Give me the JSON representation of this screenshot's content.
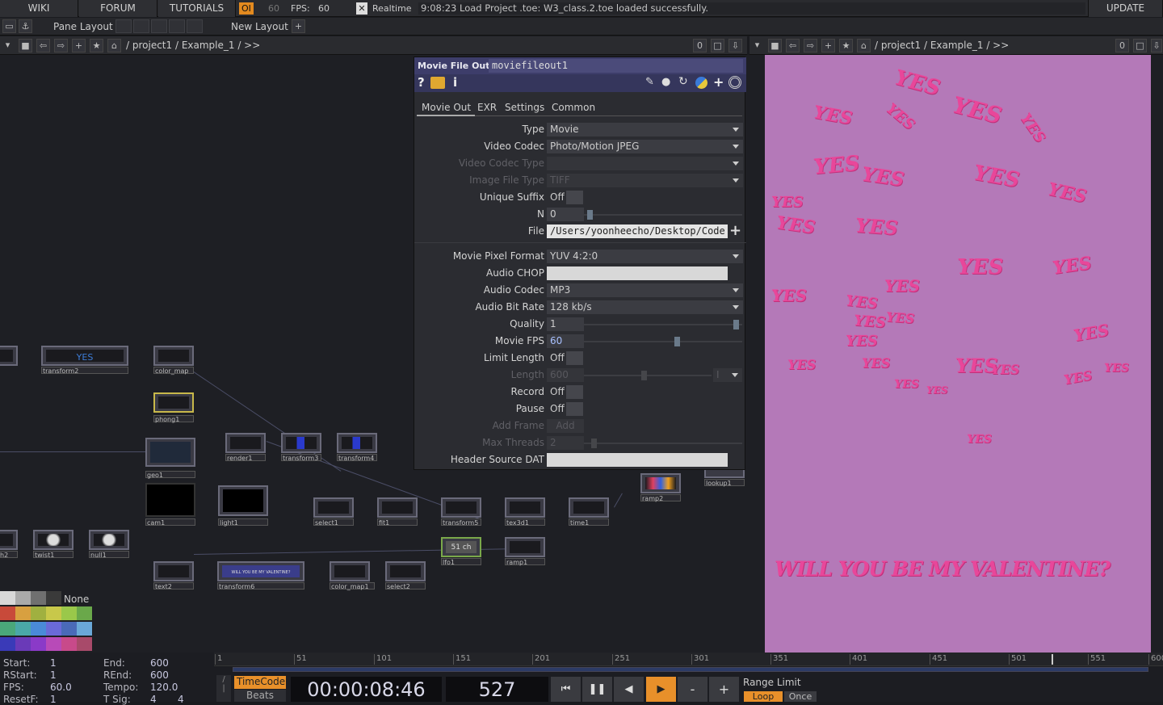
{
  "topbar": {
    "wiki": "WIKI",
    "forum": "FORUM",
    "tutorials": "TUTORIALS",
    "oi": "OI",
    "fps_target": "60",
    "fps_label": "FPS:",
    "fps_value": "60",
    "realtime_check": "✕",
    "realtime_label": "Realtime",
    "status_message": "9:08:23 Load Project .toe: W3_class.2.toe loaded successfully.",
    "update": "UPDATE"
  },
  "bar2": {
    "pane_layout": "Pane Layout",
    "new_layout": "New Layout",
    "plus": "+"
  },
  "left_path": {
    "path": "/ project1 / Example_1 / >>",
    "zero": "0"
  },
  "right_path": {
    "path": "/ project1 / Example_1 / >>",
    "zero": "0"
  },
  "param": {
    "op_type": "Movie File Out",
    "op_name": "moviefileout1",
    "tabs": [
      "Movie Out",
      "EXR",
      "Settings",
      "Common"
    ],
    "rows": [
      {
        "label": "Type",
        "value": "Movie",
        "kind": "dropdown",
        "dim": false
      },
      {
        "label": "Video Codec",
        "value": "Photo/Motion JPEG",
        "kind": "dropdown",
        "dim": false
      },
      {
        "label": "Video Codec Type",
        "value": "",
        "kind": "dropdown",
        "dim": true
      },
      {
        "label": "Image File Type",
        "value": "TIFF",
        "kind": "dropdown",
        "dim": true
      },
      {
        "label": "Unique Suffix",
        "value": "Off",
        "kind": "toggle",
        "dim": false
      },
      {
        "label": "N",
        "value": "0",
        "kind": "slider",
        "dim": false
      },
      {
        "label": "File",
        "value": "/Users/yoonheecho/Desktop/Code",
        "kind": "file",
        "dim": false
      },
      {
        "label": "Movie Pixel Format",
        "value": "YUV 4:2:0",
        "kind": "dropdown",
        "dim": false
      },
      {
        "label": "Audio CHOP",
        "value": "",
        "kind": "opref",
        "dim": false
      },
      {
        "label": "Audio Codec",
        "value": "MP3",
        "kind": "dropdown",
        "dim": false
      },
      {
        "label": "Audio Bit Rate",
        "value": "128 kb/s",
        "kind": "dropdown",
        "dim": false
      },
      {
        "label": "Quality",
        "value": "1",
        "kind": "slider",
        "dim": false
      },
      {
        "label": "Movie FPS",
        "value": "60",
        "kind": "slider",
        "dim": false
      },
      {
        "label": "Limit Length",
        "value": "Off",
        "kind": "toggle",
        "dim": false
      },
      {
        "label": "Length",
        "value": "600",
        "kind": "slider-unit",
        "dim": true,
        "unit": "I"
      },
      {
        "label": "Record",
        "value": "Off",
        "kind": "toggle",
        "dim": false
      },
      {
        "label": "Pause",
        "value": "Off",
        "kind": "toggle",
        "dim": false
      },
      {
        "label": "Add Frame",
        "value": "Add",
        "kind": "button",
        "dim": true
      },
      {
        "label": "Max Threads",
        "value": "2",
        "kind": "slider",
        "dim": true
      },
      {
        "label": "Header Source DAT",
        "value": "",
        "kind": "opref",
        "dim": false
      }
    ]
  },
  "nodes": [
    {
      "name": "transform2",
      "label": "transform2",
      "thumb": "YES"
    },
    {
      "name": "color-map",
      "label": "color_map",
      "thumb": ""
    },
    {
      "name": "phong1",
      "label": "phong1",
      "thumb": ""
    },
    {
      "name": "geo1",
      "label": "geo1",
      "thumb": ""
    },
    {
      "name": "render1",
      "label": "render1",
      "thumb": ""
    },
    {
      "name": "transform3",
      "label": "transform3",
      "thumb": ""
    },
    {
      "name": "transform4",
      "label": "transform4",
      "thumb": ""
    },
    {
      "name": "cam1",
      "label": "cam1",
      "thumb": ""
    },
    {
      "name": "light1",
      "label": "light1",
      "thumb": ""
    },
    {
      "name": "select1",
      "label": "select1",
      "thumb": ""
    },
    {
      "name": "fit1",
      "label": "fit1",
      "thumb": ""
    },
    {
      "name": "transform5",
      "label": "transform5",
      "thumb": ""
    },
    {
      "name": "tex3d1",
      "label": "tex3d1",
      "thumb": ""
    },
    {
      "name": "time1",
      "label": "time1",
      "thumb": ""
    },
    {
      "name": "ramp2",
      "label": "ramp2",
      "thumb": ""
    },
    {
      "name": "lookup1",
      "label": "lookup1",
      "thumb": ""
    },
    {
      "name": "lfo1",
      "label": "lfo1",
      "thumb": "51 ch"
    },
    {
      "name": "ramp1",
      "label": "ramp1",
      "thumb": ""
    },
    {
      "name": "twist1",
      "label": "twist1",
      "thumb": ""
    },
    {
      "name": "null1",
      "label": "null1",
      "thumb": ""
    },
    {
      "name": "h2",
      "label": "h2",
      "thumb": ""
    },
    {
      "name": "text2",
      "label": "text2",
      "thumb": ""
    },
    {
      "name": "transform6",
      "label": "transform6",
      "thumb": "WILL YOU BE MY VALENTINE?"
    },
    {
      "name": "color-map1",
      "label": "color_map1",
      "thumb": ""
    },
    {
      "name": "select2",
      "label": "select2",
      "thumb": ""
    }
  ],
  "palette": {
    "none_label": "None"
  },
  "viewer": {
    "yes_word": "YES",
    "valentine": "WILL YOU BE MY VALENTINE?",
    "bg": "#b479b8",
    "text_color": "#e8479a"
  },
  "timeline": {
    "start_label": "Start:",
    "start": "1",
    "rstart_label": "RStart:",
    "rstart": "1",
    "fps_label": "FPS:",
    "fps": "60.0",
    "resetf_label": "ResetF:",
    "resetf": "1",
    "end_label": "End:",
    "end": "600",
    "rend_label": "REnd:",
    "rend": "600",
    "tempo_label": "Tempo:",
    "tempo": "120.0",
    "tsig_label": "T Sig:",
    "tsig_a": "4",
    "tsig_b": "4",
    "ticks": [
      "1",
      "51",
      "101",
      "151",
      "201",
      "251",
      "301",
      "351",
      "401",
      "451",
      "501",
      "551",
      "600"
    ],
    "timecode_label": "TimeCode",
    "beats_label": "Beats",
    "timecode": "00:00:08:46",
    "frame": "527",
    "range_limit": "Range Limit",
    "loop": "Loop",
    "once": "Once",
    "minus": "-",
    "plus": "+"
  }
}
